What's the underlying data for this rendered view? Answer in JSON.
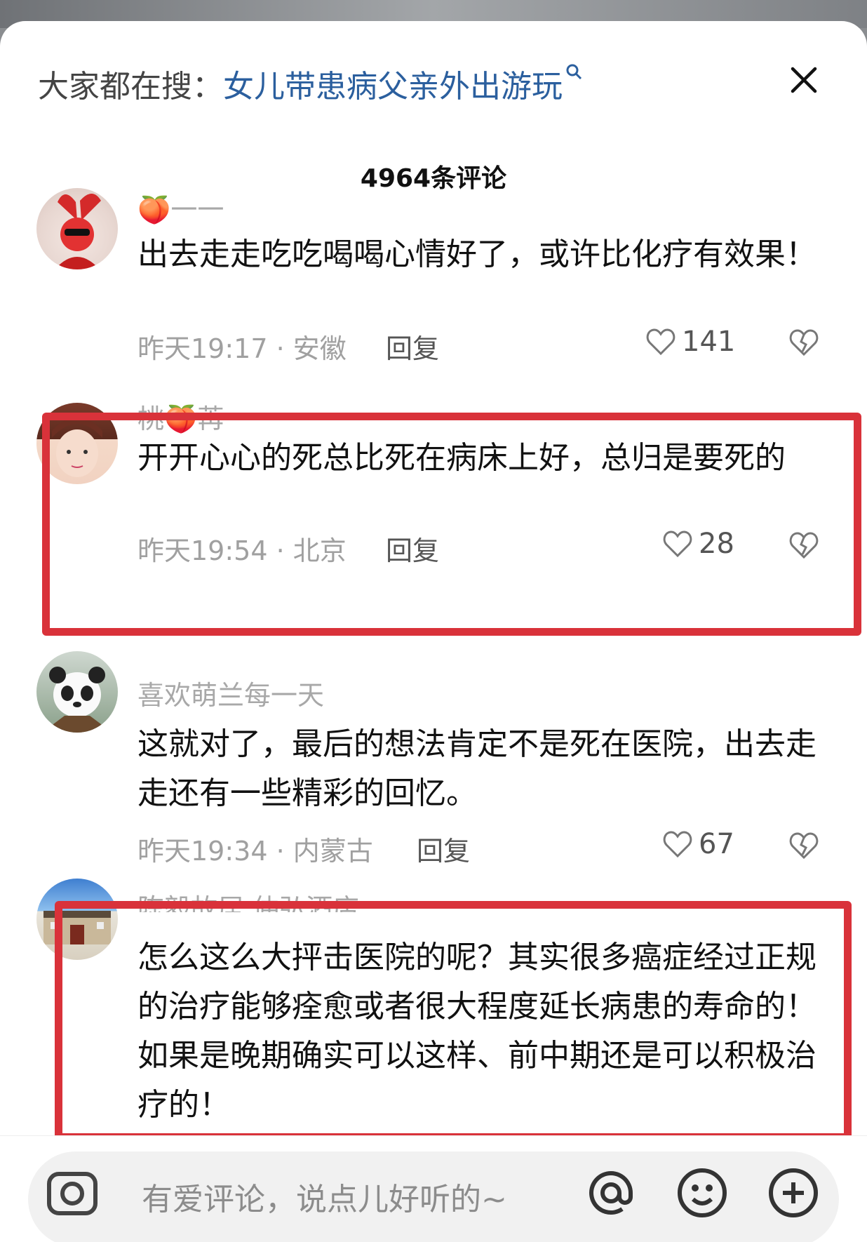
{
  "search": {
    "prefix": "大家都在搜：",
    "query": "女儿带患病父亲外出游玩"
  },
  "comments_header": {
    "count_label": "4964条评论"
  },
  "comments": [
    {
      "username": "🍑一一",
      "text": "出去走走吃吃喝喝心情好了，或许比化疗有效果！",
      "time_location": "昨天19:17 · 安徽",
      "reply_label": "回复",
      "likes": "141"
    },
    {
      "username": "桃🍑苒",
      "text": "开开心心的死总比死在病床上好，总归是要死的",
      "time_location": "昨天19:54 · 北京",
      "reply_label": "回复",
      "likes": "28"
    },
    {
      "username": "喜欢萌兰每一天",
      "text": "这就对了，最后的想法肯定不是死在医院，出去走走还有一些精彩的回忆。",
      "time_location": "昨天19:34 · 内蒙古",
      "reply_label": "回复",
      "likes": "67"
    },
    {
      "username": "陈毅故居 仲弘酒店",
      "text": "怎么这么大抨击医院的呢？其实很多癌症经过正规的治疗能够痊愈或者很大程度延长病患的寿命的！如果是晚期确实可以这样、前中期还是可以积极治疗的！"
    }
  ],
  "composer": {
    "placeholder": "有爱评论，说点儿好听的~"
  },
  "colors": {
    "highlight_box": "#d9323a",
    "search_link": "#2b5f9e"
  },
  "icons": [
    "search-icon",
    "close-icon",
    "heart-icon",
    "broken-heart-icon",
    "camera-icon",
    "at-icon",
    "emoji-icon",
    "plus-icon"
  ]
}
